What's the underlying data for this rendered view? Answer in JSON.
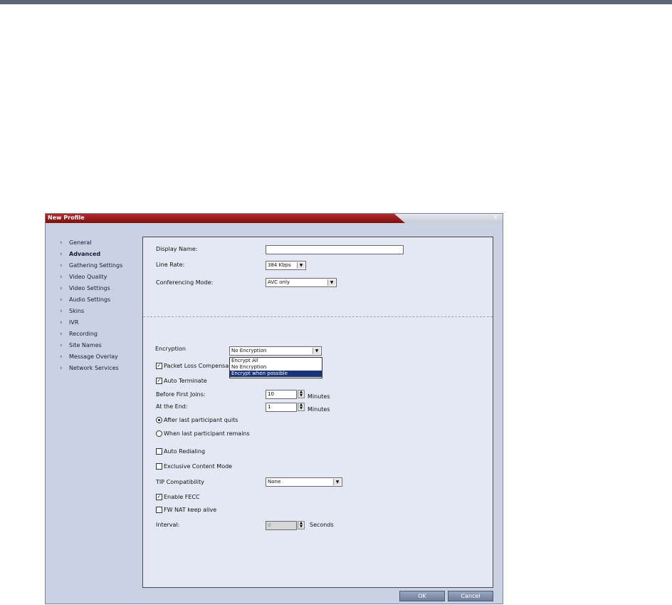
{
  "window": {
    "title": "New Profile",
    "close_glyph": "×"
  },
  "nav": {
    "items": [
      {
        "label": "General"
      },
      {
        "label": "Advanced",
        "active": true
      },
      {
        "label": "Gathering Settings"
      },
      {
        "label": "Video Quality"
      },
      {
        "label": "Video Settings"
      },
      {
        "label": "Audio Settings"
      },
      {
        "label": "Skins"
      },
      {
        "label": "IVR"
      },
      {
        "label": "Recording"
      },
      {
        "label": "Site Names"
      },
      {
        "label": "Message Overlay"
      },
      {
        "label": "Network Services"
      }
    ]
  },
  "form": {
    "display_name": {
      "label": "Display Name:",
      "value": ""
    },
    "line_rate": {
      "label": "Line Rate:",
      "value": "384 Kbps"
    },
    "conferencing_mode": {
      "label": "Conferencing Mode:",
      "value": "AVC only"
    },
    "encryption": {
      "label": "Encryption",
      "value": "No Encryption",
      "options": [
        "Encrypt All",
        "No Encryption",
        "Encrypt when possible"
      ],
      "highlighted": "Encrypt when possible"
    },
    "packet_loss": {
      "label": "Packet Loss Compensa",
      "checked": true
    },
    "auto_terminate": {
      "label": "Auto Terminate",
      "checked": true
    },
    "before_first_joins": {
      "label": "Before First Joins:",
      "value": "10",
      "unit": "Minutes"
    },
    "at_the_end": {
      "label": "At the End:",
      "value": "1",
      "unit": "Minutes"
    },
    "after_last_quits": {
      "label": "After last participant quits",
      "selected": true
    },
    "when_last_remains": {
      "label": "When last participant remains",
      "selected": false
    },
    "auto_redialing": {
      "label": "Auto Redialing",
      "checked": false
    },
    "exclusive_content": {
      "label": "Exclusive Content Mode",
      "checked": false
    },
    "tip_compat": {
      "label": "TIP Compatibility",
      "value": "None"
    },
    "enable_fecc": {
      "label": "Enable FECC",
      "checked": true
    },
    "fw_nat": {
      "label": "FW NAT keep alive",
      "checked": false
    },
    "interval": {
      "label": "Interval:",
      "value": "0",
      "unit": "Seconds"
    }
  },
  "buttons": {
    "ok": "OK",
    "cancel": "Cancel"
  },
  "glyphs": {
    "check": "✓",
    "arrow_down": "▼",
    "chevron": "›",
    "spin_up": "▲",
    "spin_down": "▼"
  }
}
